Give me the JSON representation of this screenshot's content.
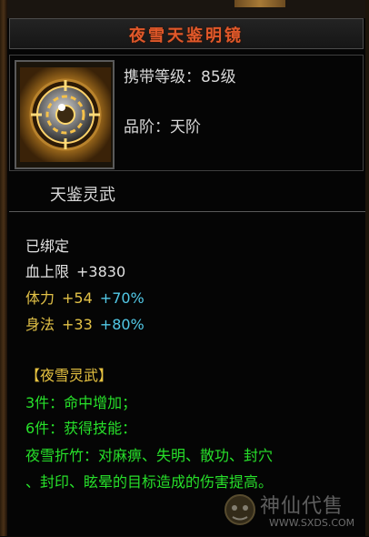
{
  "item": {
    "name": "夜雪天鉴明镜",
    "level_label": "携带等级：85级",
    "rank_label": "品阶：天阶",
    "category": "天鉴灵武"
  },
  "stats": {
    "bound": "已绑定",
    "hp_label": "血上限",
    "hp_value": "+3830",
    "str_label": "体力",
    "str_value": "+54",
    "str_pct": "+70%",
    "agi_label": "身法",
    "agi_value": "+33",
    "agi_pct": "+80%"
  },
  "set": {
    "title": "【夜雪灵武】",
    "piece3": "3件：命中增加；",
    "piece6": "6件：获得技能：",
    "skill_line1": "夜雪折竹：对麻痹、失明、散功、封穴",
    "skill_line2": "、封印、眩晕的目标造成的伤害提高。"
  },
  "watermark": {
    "text": "神仙代售",
    "url": "WWW.SXDS.COM"
  },
  "colors": {
    "title": "#e0582a",
    "white": "#e2e2e2",
    "yellow": "#e3c247",
    "cyan": "#52c9e7",
    "green": "#27e02a"
  },
  "icon": "golden-mirror-icon"
}
